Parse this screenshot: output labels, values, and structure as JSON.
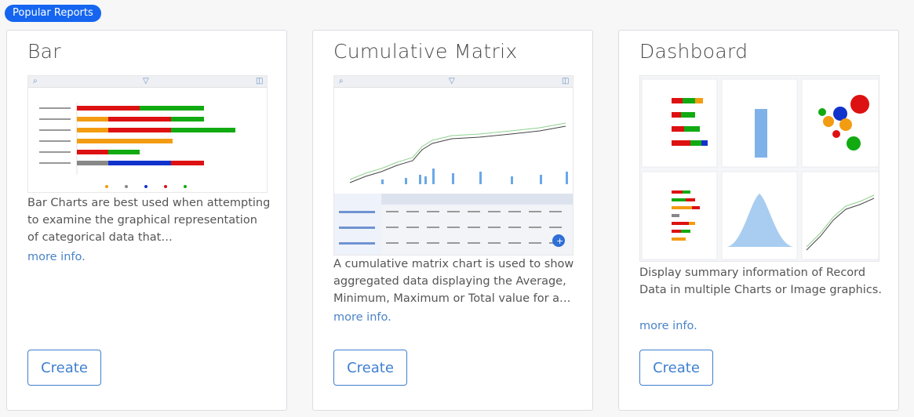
{
  "header": {
    "badge_label": "Popular Reports"
  },
  "colors": {
    "accent": "#1565f0",
    "link": "#4a83c7",
    "button": "#3f7fd0"
  },
  "cards": [
    {
      "title": "Bar",
      "description": "Bar Charts are best used when attempting to examine the graphical representation of categorical data that…",
      "more_label": "more info.",
      "create_label": "Create"
    },
    {
      "title": "Cumulative Matrix",
      "description": "A cumulative matrix chart is used to show aggregated data displaying the Average, Minimum, Maximum or Total value for a…",
      "more_label": "more info.",
      "create_label": "Create"
    },
    {
      "title": "Dashboard",
      "description": "Display summary information of Record Data in multiple Charts or Image graphics.",
      "more_label": "more info.",
      "create_label": "Create"
    }
  ]
}
